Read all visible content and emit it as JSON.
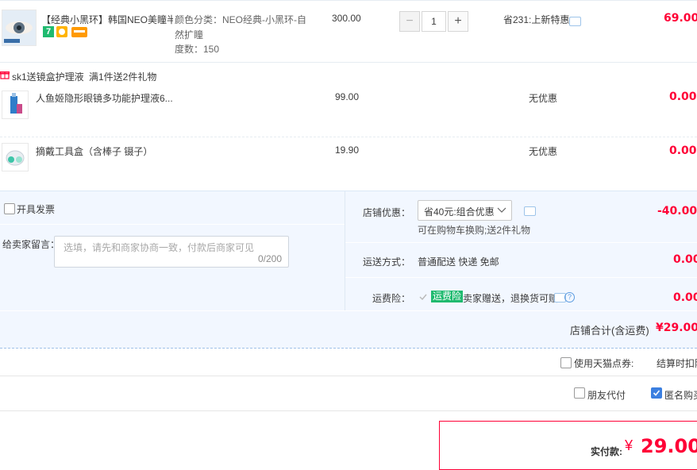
{
  "items": [
    {
      "title": "【经典小黑环】韩国NEO美瞳半...",
      "sku_line1": "颜色分类：NEO经典-小黑环-自",
      "sku_line2": "然扩瞳",
      "sku_line3": "度数：150",
      "price": "300.00",
      "quantity": "1",
      "qty_minus": "−",
      "qty_plus": "+",
      "promo": "省231:上新特惠",
      "subtotal": "69.00",
      "badge_text": "7"
    }
  ],
  "gift_bar": {
    "label": "sk1送镜盒护理液",
    "note": "满1件送2件礼物"
  },
  "gifts": [
    {
      "title": "人鱼姬隐形眼镜多功能护理液6...",
      "price": "99.00",
      "promo": "无优惠",
      "subtotal": "0.00"
    },
    {
      "title": "摘戴工具盒（含棒子 镊子）",
      "price": "19.90",
      "promo": "无优惠",
      "subtotal": "0.00"
    }
  ],
  "invoice": {
    "label": "开具发票"
  },
  "message": {
    "label": "给卖家留言：",
    "placeholder": "选填，请先和商家协商一致，付款后商家可见",
    "counter": "0/200"
  },
  "shop_discount": {
    "label": "店铺优惠：",
    "selected": "省40元:组合优惠",
    "note": "可在购物车换购;送2件礼物",
    "amount": "-40.00"
  },
  "shipping": {
    "label": "运送方式：",
    "value": "普通配送 快递 免邮",
    "amount": "0.00"
  },
  "insurance": {
    "label": "运费险：",
    "tag": "运费险",
    "desc": "卖家赠送，退换货可赔",
    "amount": "0.00"
  },
  "shop_total": {
    "label": "店铺合计(含运费)",
    "amount": "¥29.00"
  },
  "coupon": {
    "label": "使用天猫点券:",
    "note": "结算时扣除"
  },
  "options": {
    "friend_pay": "朋友代付",
    "anonymous": "匿名购买"
  },
  "final": {
    "label": "实付款:",
    "currency": "¥",
    "amount": "29.00"
  },
  "colors": {
    "accent_red": "#ff0036",
    "panel_blue": "#f2f7ff",
    "checkbox_blue": "#3b7fe0",
    "green_badge": "#1fba6f"
  }
}
